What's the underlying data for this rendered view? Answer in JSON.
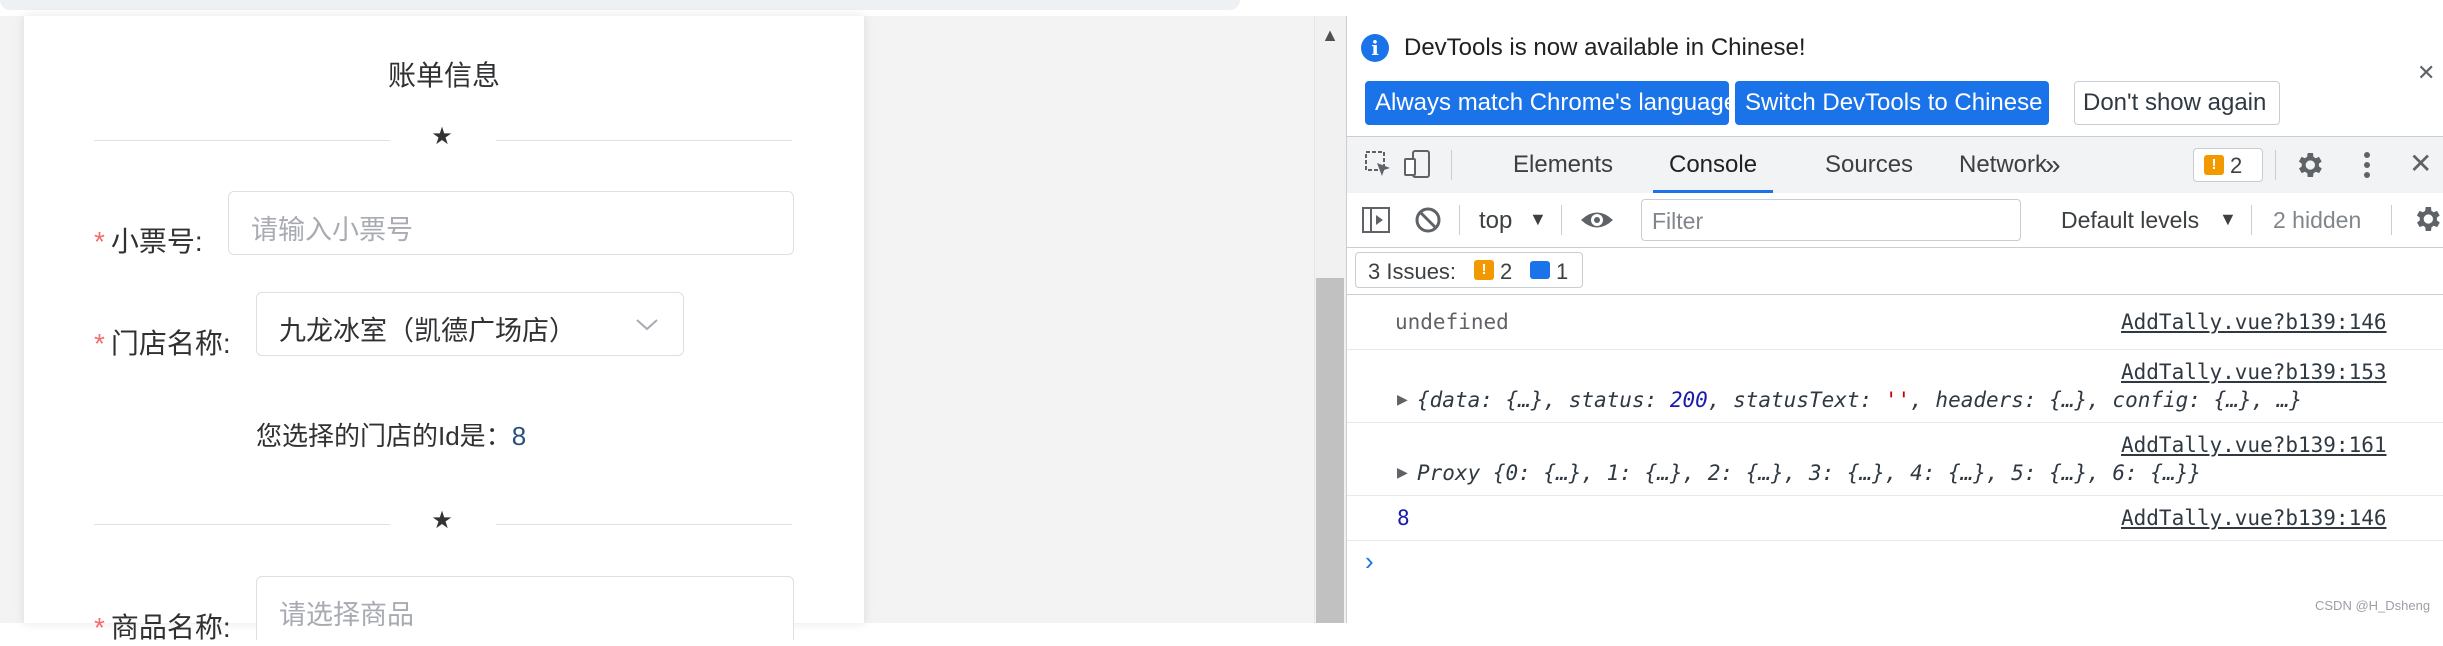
{
  "form": {
    "title": "账单信息",
    "divider_star": "★",
    "required_mark": "*",
    "receipt_label": "小票号:",
    "receipt_placeholder": "请输入小票号",
    "store_label": "门店名称:",
    "store_value": "九龙冰室（凯德广场店）",
    "selected_prefix": "您选择的门店的Id是：",
    "selected_id": "8",
    "goods_label": "商品名称:",
    "goods_placeholder": "请选择商品"
  },
  "devtools": {
    "banner_text": "DevTools is now available in Chinese!",
    "btn_match": "Always match Chrome's language",
    "btn_switch": "Switch DevTools to Chinese",
    "btn_dont": "Don't show again",
    "tabs": [
      "Elements",
      "Console",
      "Sources",
      "Network"
    ],
    "active_tab": "Console",
    "more_tabs": "»",
    "issues_count": "2",
    "context": "top",
    "filter_placeholder": "Filter",
    "levels": "Default levels",
    "hidden": "2 hidden",
    "issues_label": "3 Issues:",
    "issues_warn": "2",
    "issues_info": "1",
    "logs": [
      {
        "text": "undefined",
        "source": "AddTally.vue?b139:146"
      },
      {
        "source": "AddTally.vue?b139:153"
      },
      {
        "source": "AddTally.vue?b139:161"
      },
      {
        "text": "8",
        "source": "AddTally.vue?b139:146"
      }
    ],
    "log2": {
      "open": "{",
      "data_k": "data: ",
      "data_v": "{…}",
      "status_k": ", status: ",
      "status_v": "200",
      "st_k": ", statusText: ",
      "st_v": "''",
      "rest": ", headers: {…}, config: {…}, …}"
    },
    "log3": "Proxy {0: {…}, 1: {…}, 2: {…}, 3: {…}, 4: {…}, 5: {…}, 6: {…}}",
    "prompt": "›",
    "watermark": "CSDN @H_Dsheng"
  },
  "colors": {
    "accent": "#1a73e8",
    "required": "#f56c6c",
    "warning": "#f29900"
  },
  "icons": [
    "info-icon",
    "close-icon",
    "inspect-icon",
    "device-toggle-icon",
    "settings-icon",
    "kebab-menu-icon",
    "sidebar-toggle-icon",
    "clear-console-icon",
    "eye-icon",
    "chevron-down-icon",
    "star-icon"
  ]
}
